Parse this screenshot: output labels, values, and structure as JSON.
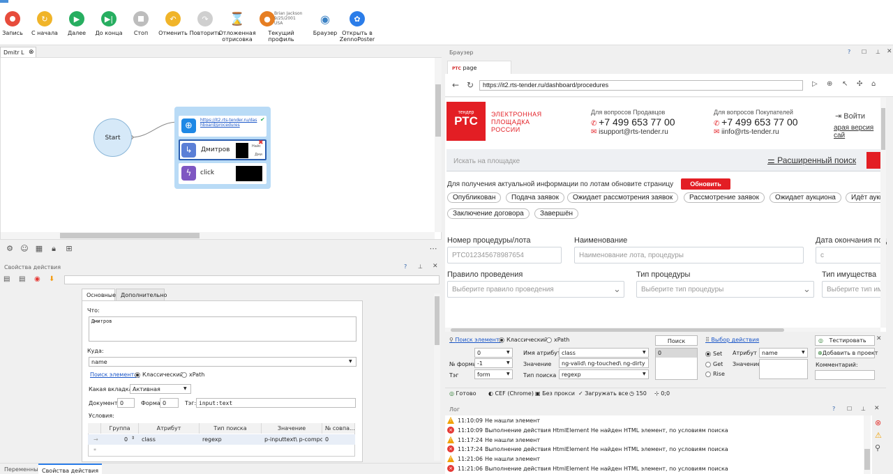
{
  "toolbar": {
    "items": [
      {
        "label": "Запись",
        "icon": "record-icon",
        "color": "#e74c3c"
      },
      {
        "label": "С начала",
        "icon": "restart-icon",
        "color": "#f0b429"
      },
      {
        "label": "Далее",
        "icon": "play-icon",
        "color": "#27ae60"
      },
      {
        "label": "До конца",
        "icon": "skip-to-end-icon",
        "color": "#27ae60"
      },
      {
        "label": "Стоп",
        "icon": "stop-icon",
        "color": "#bdbdbd"
      },
      {
        "label": "Отменить",
        "icon": "undo-icon",
        "color": "#f0b429"
      },
      {
        "label": "Повторить",
        "icon": "redo-icon",
        "color": "#cfcfcf"
      },
      {
        "label": "Отложенная отрисовка",
        "icon": "hourglass-icon",
        "color": "#8a6d3b"
      },
      {
        "label": "Текущий профиль",
        "icon": "profile-icon",
        "color": "#e67e22"
      },
      {
        "label": "Браузер",
        "icon": "eye-icon",
        "color": "#3b82c4"
      },
      {
        "label": "Открыть в ZennoPoster",
        "icon": "zennoposter-icon",
        "color": "#2b7de9"
      }
    ],
    "profile": {
      "name": "Brian Jackson",
      "date": "9/25/2001",
      "country": "USA"
    }
  },
  "canvas": {
    "tab_label": "Dmitr L",
    "start_label": "Start",
    "nodes": [
      {
        "label": "https://it2.rts-tender.ru/dashboard/procedures",
        "icon": "globe-icon"
      },
      {
        "label": "Дмитров",
        "icon": "redirect-icon",
        "mini_top": "Найс",
        "mini_bottom": "Дми"
      },
      {
        "label": "click",
        "icon": "lightning-icon"
      }
    ]
  },
  "props": {
    "title": "Свойства действия",
    "tabs": [
      "Основные",
      "Дополнительно"
    ],
    "what_label": "Что:",
    "what_value": "Дмитров",
    "where_label": "Куда:",
    "where_value": "name",
    "search_label": "Поиск элемента:",
    "search_opt1": "Классический",
    "search_opt2": "xPath",
    "tab_label": "Какая вкладка:",
    "tab_value": "Активная",
    "doc_label": "Документ:",
    "doc_value": "0",
    "form_label": "Форма:",
    "form_value": "0",
    "tag_label": "Тэг:",
    "tag_value": "input:text",
    "conditions_label": "Условия:",
    "table": {
      "headers": [
        "Группа",
        "Атрибут",
        "Тип поиска",
        "Значение",
        "№ совпа..."
      ],
      "row": {
        "group": "0",
        "attr": "class",
        "type": "regexp",
        "value": "p-inputtext\\ p-compon...",
        "num": "0"
      }
    }
  },
  "bottom_tabs": [
    "Переменные",
    "Свойства действия"
  ],
  "browser": {
    "title": "Браузер",
    "tab_label": "page",
    "tab_favicon": "РТС",
    "url": "https://it2.rts-tender.ru/dashboard/procedures",
    "site": {
      "logo_small": "тендер",
      "logo": "РТС",
      "brand_lines": [
        "ЭЛЕКТРОННАЯ",
        "ПЛОЩАДКА",
        "РОССИИ"
      ],
      "sellers_title": "Для вопросов Продавцов",
      "sellers_phone": "+7 499 653 77 00",
      "sellers_email": "isupport@rts-tender.ru",
      "buyers_title": "Для вопросов Покупателей",
      "buyers_phone": "+7 499 653 77 00",
      "buyers_email": "iinfo@rts-tender.ru",
      "login": "Войти",
      "old_version": "арая версия сай",
      "search_placeholder": "Искать на площадке",
      "advanced_search": "Расширенный поиск",
      "notice": "Для получения актуальной информации по лотам обновите страницу",
      "refresh_btn": "Обновить",
      "statuses": [
        "Опубликован",
        "Подача заявок",
        "Ожидает рассмотрения заявок",
        "Рассмотрение заявок",
        "Ожидает аукциона",
        "Идёт аукц"
      ],
      "statuses2": [
        "Заключение договора",
        "Завершён"
      ],
      "proc_num_label": "Номер процедуры/лота",
      "proc_num_ph": "РТС012345678987654",
      "name_label": "Наименование",
      "name_ph": "Наименование лота, процедуры",
      "deadline_label": "Дата окончания под",
      "deadline_ph": "с",
      "rule_label": "Правило проведения",
      "rule_ph": "Выберите правило проведения",
      "type_label": "Тип процедуры",
      "type_ph": "Выберите тип процедуры",
      "prop_label": "Тип имущества",
      "prop_ph": "Выберите тип им"
    }
  },
  "finder": {
    "search_link": "Поиск элемента",
    "classic": "Классический",
    "xpath": "xPath",
    "search_btn": "Поиск",
    "result": "0",
    "action_link": "Выбор действия",
    "test_btn": "Тестировать",
    "add_btn": "Добавить в проект",
    "form_label": "№ формы",
    "form_value": "-1",
    "doc_value": "0",
    "tag_label": "Тэг",
    "tag_value": "form",
    "attr_name_label": "Имя атрибута",
    "attr_name_value": "class",
    "value_label": "Значение",
    "value_value": "ng-valid\\ ng-touched\\ ng-dirty",
    "search_type_label": "Тип поиска",
    "search_type_value": "regexp",
    "set": "Set",
    "get": "Get",
    "rise": "Rise",
    "attr_label": "Атрибут",
    "attr_value": "name",
    "val_label": "Значение",
    "comment_label": "Комментарий:"
  },
  "status": {
    "ready": "Готово",
    "engine": "CEF (Chrome)",
    "proxy": "Без прокси",
    "load": "Загружать все",
    "timer": "150",
    "coords": "0;0"
  },
  "log": {
    "title": "Лог",
    "rows": [
      {
        "level": "warn",
        "time": "11:10:09",
        "msg": "Не нашли элемент"
      },
      {
        "level": "error",
        "time": "11:10:09",
        "msg": "Выполнение действия HtmlElement Не найден HTML элемент, по условиям поиска"
      },
      {
        "level": "warn",
        "time": "11:17:24",
        "msg": "Не нашли элемент"
      },
      {
        "level": "error",
        "time": "11:17:24",
        "msg": "Выполнение действия HtmlElement Не найден HTML элемент, по условиям поиска"
      },
      {
        "level": "warn",
        "time": "11:21:06",
        "msg": "Не нашли элемент"
      },
      {
        "level": "error",
        "time": "11:21:06",
        "msg": "Выполнение действия HtmlElement Не найден HTML элемент, по условиям поиска"
      }
    ]
  }
}
